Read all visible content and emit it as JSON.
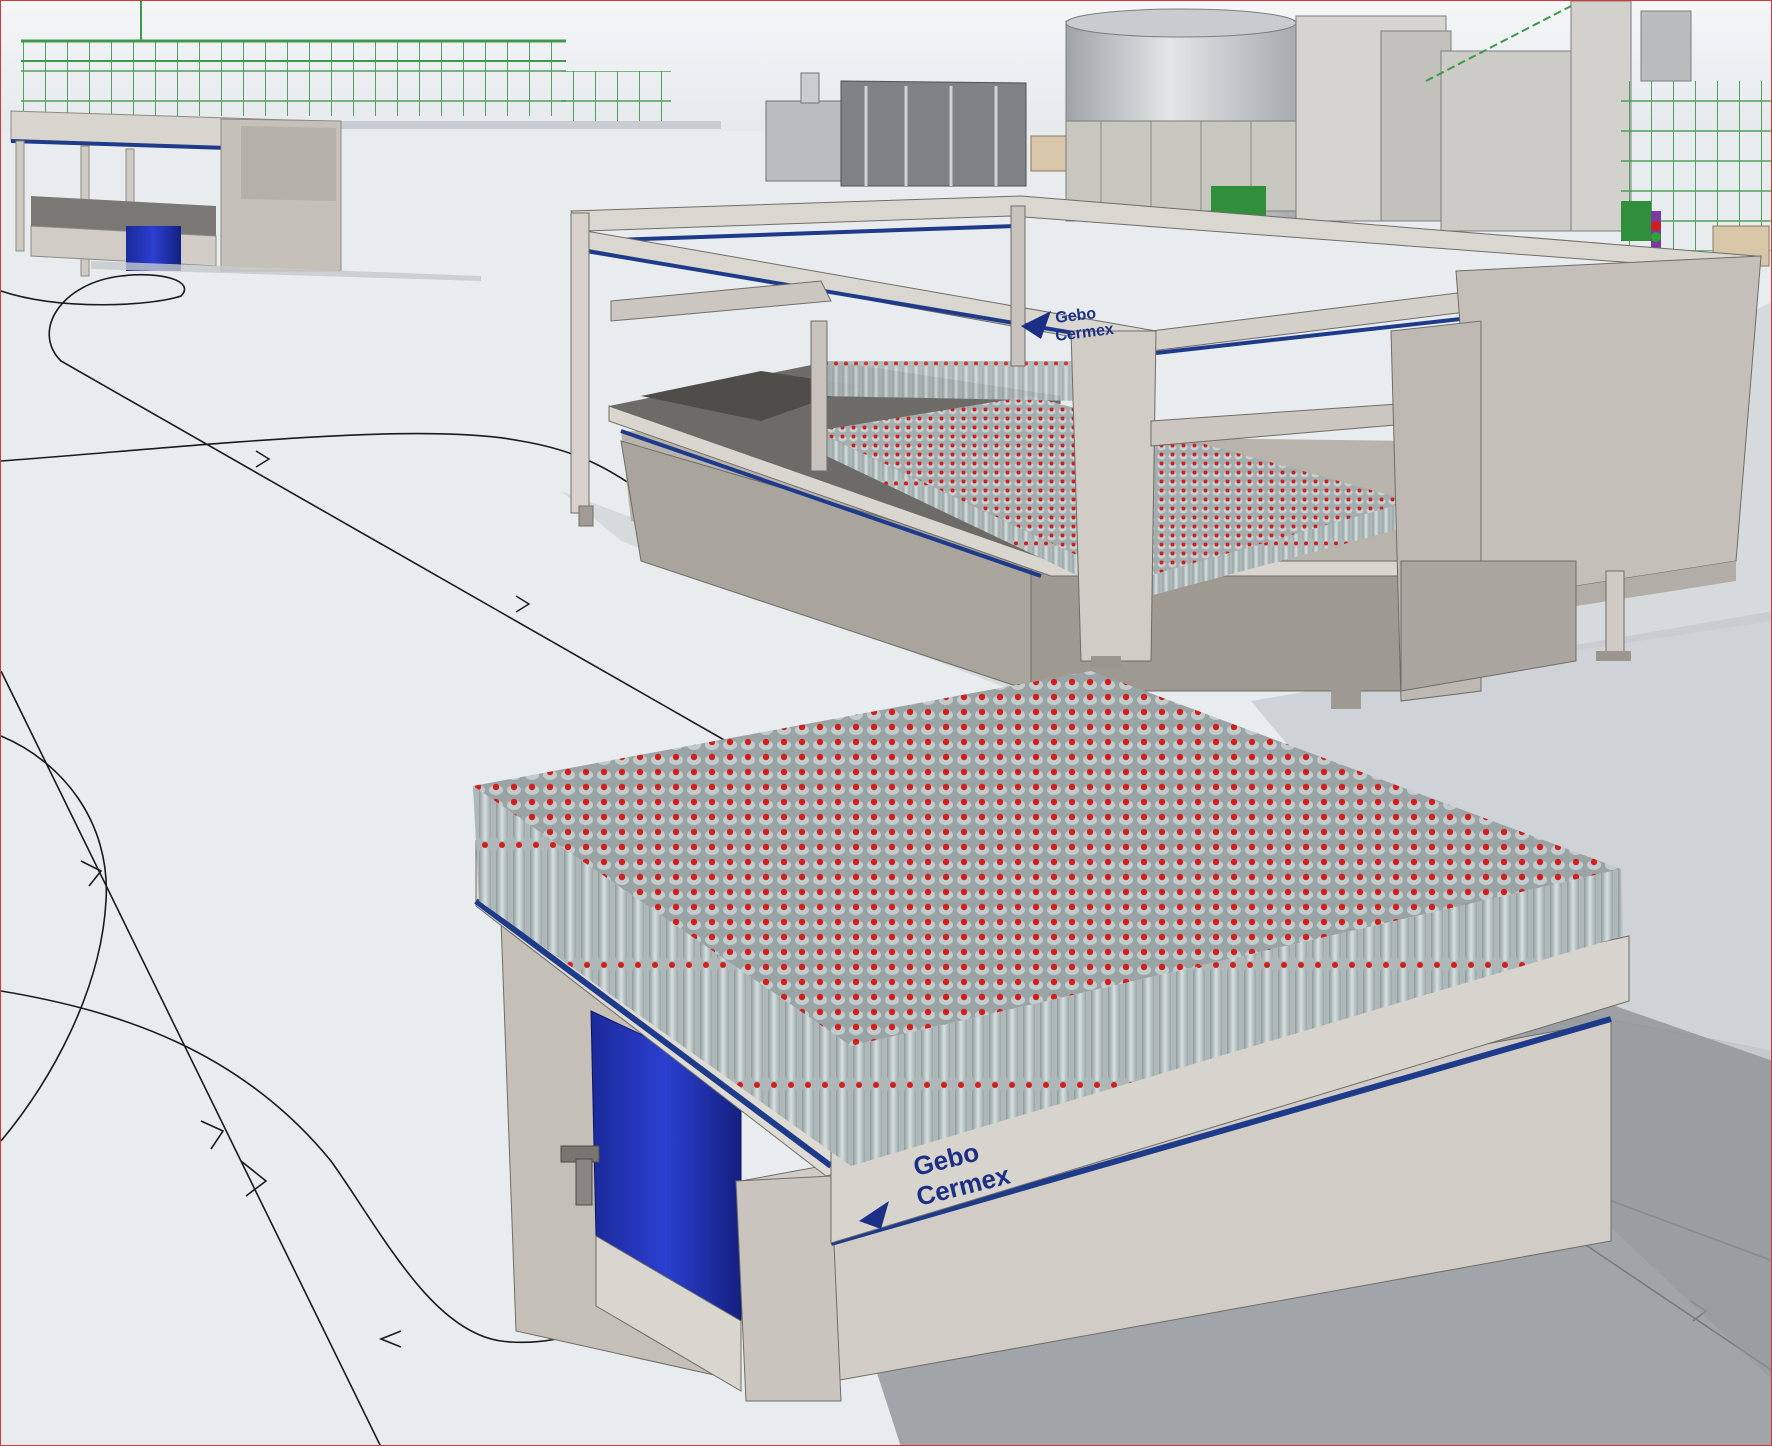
{
  "scene": {
    "brand": {
      "line1": "Gebo",
      "line2": "Cermex"
    },
    "colors": {
      "floor": "#e9ecef",
      "machine_gray": "#cfcac2",
      "stripe_blue": "#1e3a8a",
      "curtain_blue": "#1e2fa8",
      "bottle_cap": "#d11e1e",
      "bottle_body": "#b9c4c4",
      "scaffold_green": "#3e9a4a"
    },
    "icons": [
      "gebo-cermex-logo-icon",
      "red-bottle-cap-icon",
      "path-direction-arrow-icon"
    ]
  }
}
